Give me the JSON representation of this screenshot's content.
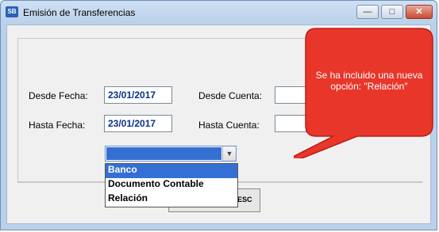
{
  "window": {
    "title": "Emisión de Transferencias",
    "icon_text": "SB"
  },
  "form": {
    "desde_fecha_label": "Desde Fecha:",
    "desde_fecha_value": "23/01/2017",
    "hasta_fecha_label": "Hasta Fecha:",
    "hasta_fecha_value": "23/01/2017",
    "desde_cuenta_label": "Desde Cuenta:",
    "hasta_cuenta_label": "Hasta Cuenta:"
  },
  "dropdown": {
    "options": [
      "Banco",
      "Documento Contable",
      "Relación"
    ],
    "highlighted_index": 0
  },
  "buttons": {
    "esc_label": "ESC"
  },
  "callout": {
    "text": "Se ha incluido una nueva opción: \"Relación\"",
    "color": "#e8362b"
  },
  "colors": {
    "accent": "#3470d4",
    "field_text": "#0b2f8a"
  }
}
